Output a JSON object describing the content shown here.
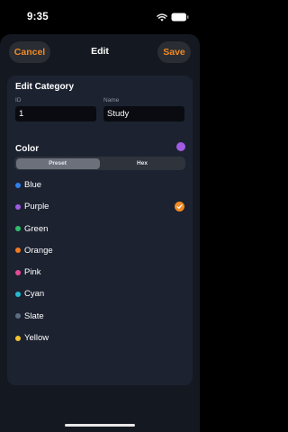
{
  "status": {
    "time": "9:35"
  },
  "nav": {
    "cancel_label": "Cancel",
    "title": "Edit",
    "save_label": "Save"
  },
  "category": {
    "title": "Edit Category",
    "id_label": "ID",
    "id_value": "1",
    "name_label": "Name",
    "name_value": "Study"
  },
  "color": {
    "title": "Color",
    "selected_color": "#a15be3",
    "tabs": [
      {
        "label": "Preset",
        "selected": true
      },
      {
        "label": "Hex",
        "selected": false
      }
    ],
    "options": [
      {
        "label": "Blue",
        "color": "#2f80ed",
        "selected": false
      },
      {
        "label": "Purple",
        "color": "#a15be3",
        "selected": true
      },
      {
        "label": "Green",
        "color": "#2fbf6a",
        "selected": false
      },
      {
        "label": "Orange",
        "color": "#f07a22",
        "selected": false
      },
      {
        "label": "Pink",
        "color": "#e84a9a",
        "selected": false
      },
      {
        "label": "Cyan",
        "color": "#25b8cf",
        "selected": false
      },
      {
        "label": "Slate",
        "color": "#5d6d82",
        "selected": false
      },
      {
        "label": "Yellow",
        "color": "#f2c230",
        "selected": false
      }
    ],
    "check_icon": "checkmark-circle-icon"
  },
  "colors": {
    "accent": "#f08a24",
    "background": "#141820",
    "card": "#1c2230"
  }
}
